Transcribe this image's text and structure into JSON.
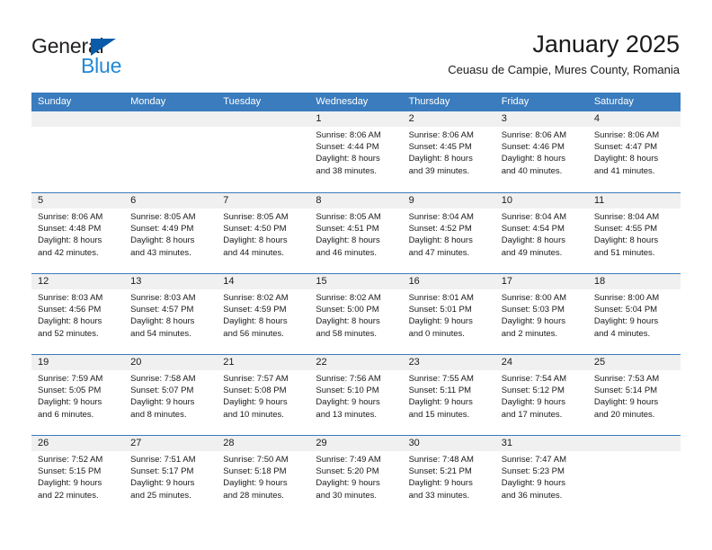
{
  "brand": {
    "name_part1": "General",
    "name_part2": "Blue",
    "color_dark": "#231f20",
    "color_blue": "#2388d6",
    "triangle_color": "#0a5ba8"
  },
  "header": {
    "title": "January 2025",
    "subtitle": "Ceuasu de Campie, Mures County, Romania"
  },
  "theme": {
    "header_row_bg": "#3a7cbe",
    "header_row_text": "#ffffff",
    "daynum_bg": "#f0f0f0",
    "cell_bg": "#ffffff",
    "grid_line": "#3a7cbe"
  },
  "weekdays": [
    "Sunday",
    "Monday",
    "Tuesday",
    "Wednesday",
    "Thursday",
    "Friday",
    "Saturday"
  ],
  "weeks": [
    [
      {
        "day": "",
        "lines": []
      },
      {
        "day": "",
        "lines": []
      },
      {
        "day": "",
        "lines": []
      },
      {
        "day": "1",
        "lines": [
          "Sunrise: 8:06 AM",
          "Sunset: 4:44 PM",
          "Daylight: 8 hours",
          "and 38 minutes."
        ]
      },
      {
        "day": "2",
        "lines": [
          "Sunrise: 8:06 AM",
          "Sunset: 4:45 PM",
          "Daylight: 8 hours",
          "and 39 minutes."
        ]
      },
      {
        "day": "3",
        "lines": [
          "Sunrise: 8:06 AM",
          "Sunset: 4:46 PM",
          "Daylight: 8 hours",
          "and 40 minutes."
        ]
      },
      {
        "day": "4",
        "lines": [
          "Sunrise: 8:06 AM",
          "Sunset: 4:47 PM",
          "Daylight: 8 hours",
          "and 41 minutes."
        ]
      }
    ],
    [
      {
        "day": "5",
        "lines": [
          "Sunrise: 8:06 AM",
          "Sunset: 4:48 PM",
          "Daylight: 8 hours",
          "and 42 minutes."
        ]
      },
      {
        "day": "6",
        "lines": [
          "Sunrise: 8:05 AM",
          "Sunset: 4:49 PM",
          "Daylight: 8 hours",
          "and 43 minutes."
        ]
      },
      {
        "day": "7",
        "lines": [
          "Sunrise: 8:05 AM",
          "Sunset: 4:50 PM",
          "Daylight: 8 hours",
          "and 44 minutes."
        ]
      },
      {
        "day": "8",
        "lines": [
          "Sunrise: 8:05 AM",
          "Sunset: 4:51 PM",
          "Daylight: 8 hours",
          "and 46 minutes."
        ]
      },
      {
        "day": "9",
        "lines": [
          "Sunrise: 8:04 AM",
          "Sunset: 4:52 PM",
          "Daylight: 8 hours",
          "and 47 minutes."
        ]
      },
      {
        "day": "10",
        "lines": [
          "Sunrise: 8:04 AM",
          "Sunset: 4:54 PM",
          "Daylight: 8 hours",
          "and 49 minutes."
        ]
      },
      {
        "day": "11",
        "lines": [
          "Sunrise: 8:04 AM",
          "Sunset: 4:55 PM",
          "Daylight: 8 hours",
          "and 51 minutes."
        ]
      }
    ],
    [
      {
        "day": "12",
        "lines": [
          "Sunrise: 8:03 AM",
          "Sunset: 4:56 PM",
          "Daylight: 8 hours",
          "and 52 minutes."
        ]
      },
      {
        "day": "13",
        "lines": [
          "Sunrise: 8:03 AM",
          "Sunset: 4:57 PM",
          "Daylight: 8 hours",
          "and 54 minutes."
        ]
      },
      {
        "day": "14",
        "lines": [
          "Sunrise: 8:02 AM",
          "Sunset: 4:59 PM",
          "Daylight: 8 hours",
          "and 56 minutes."
        ]
      },
      {
        "day": "15",
        "lines": [
          "Sunrise: 8:02 AM",
          "Sunset: 5:00 PM",
          "Daylight: 8 hours",
          "and 58 minutes."
        ]
      },
      {
        "day": "16",
        "lines": [
          "Sunrise: 8:01 AM",
          "Sunset: 5:01 PM",
          "Daylight: 9 hours",
          "and 0 minutes."
        ]
      },
      {
        "day": "17",
        "lines": [
          "Sunrise: 8:00 AM",
          "Sunset: 5:03 PM",
          "Daylight: 9 hours",
          "and 2 minutes."
        ]
      },
      {
        "day": "18",
        "lines": [
          "Sunrise: 8:00 AM",
          "Sunset: 5:04 PM",
          "Daylight: 9 hours",
          "and 4 minutes."
        ]
      }
    ],
    [
      {
        "day": "19",
        "lines": [
          "Sunrise: 7:59 AM",
          "Sunset: 5:05 PM",
          "Daylight: 9 hours",
          "and 6 minutes."
        ]
      },
      {
        "day": "20",
        "lines": [
          "Sunrise: 7:58 AM",
          "Sunset: 5:07 PM",
          "Daylight: 9 hours",
          "and 8 minutes."
        ]
      },
      {
        "day": "21",
        "lines": [
          "Sunrise: 7:57 AM",
          "Sunset: 5:08 PM",
          "Daylight: 9 hours",
          "and 10 minutes."
        ]
      },
      {
        "day": "22",
        "lines": [
          "Sunrise: 7:56 AM",
          "Sunset: 5:10 PM",
          "Daylight: 9 hours",
          "and 13 minutes."
        ]
      },
      {
        "day": "23",
        "lines": [
          "Sunrise: 7:55 AM",
          "Sunset: 5:11 PM",
          "Daylight: 9 hours",
          "and 15 minutes."
        ]
      },
      {
        "day": "24",
        "lines": [
          "Sunrise: 7:54 AM",
          "Sunset: 5:12 PM",
          "Daylight: 9 hours",
          "and 17 minutes."
        ]
      },
      {
        "day": "25",
        "lines": [
          "Sunrise: 7:53 AM",
          "Sunset: 5:14 PM",
          "Daylight: 9 hours",
          "and 20 minutes."
        ]
      }
    ],
    [
      {
        "day": "26",
        "lines": [
          "Sunrise: 7:52 AM",
          "Sunset: 5:15 PM",
          "Daylight: 9 hours",
          "and 22 minutes."
        ]
      },
      {
        "day": "27",
        "lines": [
          "Sunrise: 7:51 AM",
          "Sunset: 5:17 PM",
          "Daylight: 9 hours",
          "and 25 minutes."
        ]
      },
      {
        "day": "28",
        "lines": [
          "Sunrise: 7:50 AM",
          "Sunset: 5:18 PM",
          "Daylight: 9 hours",
          "and 28 minutes."
        ]
      },
      {
        "day": "29",
        "lines": [
          "Sunrise: 7:49 AM",
          "Sunset: 5:20 PM",
          "Daylight: 9 hours",
          "and 30 minutes."
        ]
      },
      {
        "day": "30",
        "lines": [
          "Sunrise: 7:48 AM",
          "Sunset: 5:21 PM",
          "Daylight: 9 hours",
          "and 33 minutes."
        ]
      },
      {
        "day": "31",
        "lines": [
          "Sunrise: 7:47 AM",
          "Sunset: 5:23 PM",
          "Daylight: 9 hours",
          "and 36 minutes."
        ]
      },
      {
        "day": "",
        "lines": []
      }
    ]
  ]
}
